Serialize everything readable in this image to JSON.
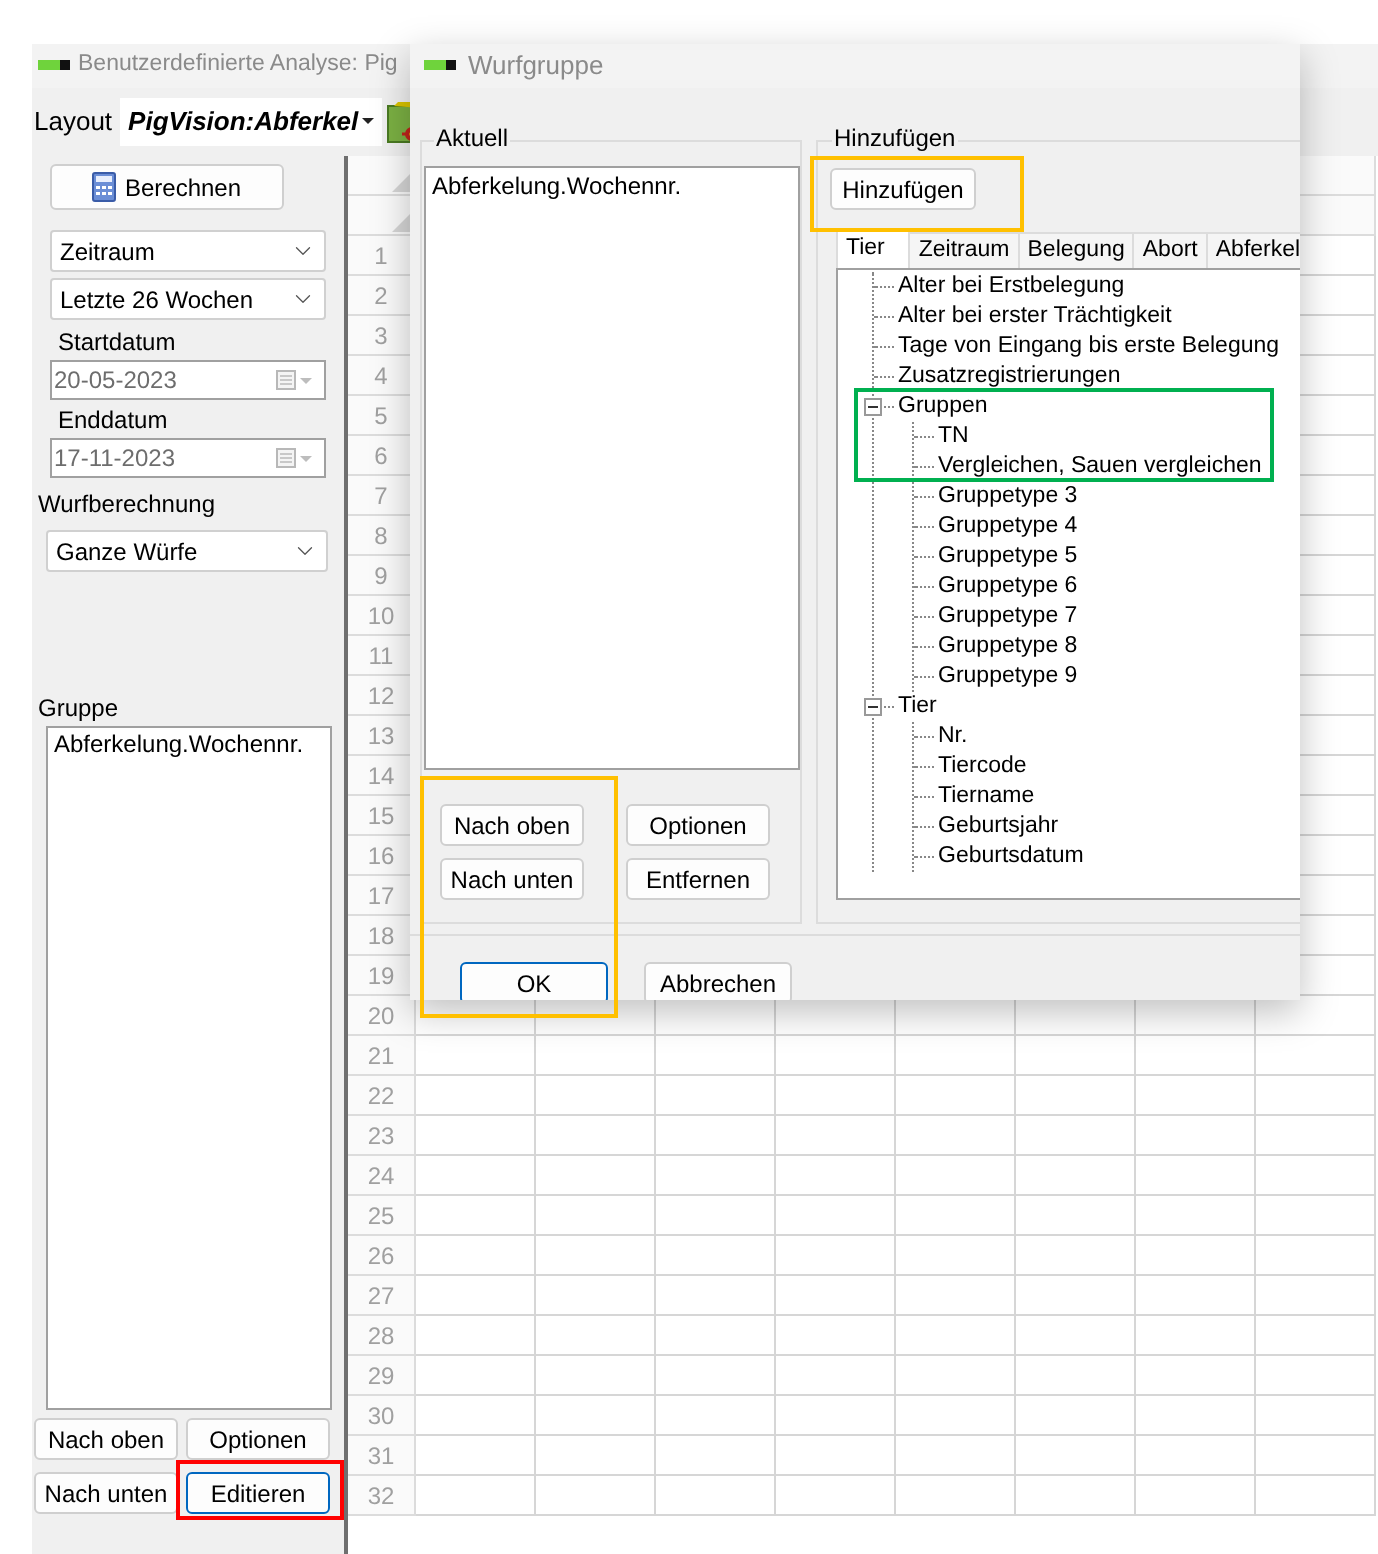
{
  "main_window": {
    "title": "Benutzerdefinierte Analyse: Pig",
    "layout_label": "Layout",
    "layout_value": "PigVision:Abferkel"
  },
  "sidebar": {
    "calculate_button": "Berechnen",
    "period_select": "Zeitraum",
    "range_select": "Letzte 26 Wochen",
    "start_label": "Startdatum",
    "start_date": {
      "value": "20-05-2023",
      "disabled": true
    },
    "end_label": "Enddatum",
    "end_date": {
      "value": "17-11-2023",
      "disabled": true
    },
    "litter_label": "Wurfberechnung",
    "litter_select": "Ganze Würfe",
    "group_label": "Gruppe",
    "group_list": [
      "Abferkelung.Wochennr."
    ],
    "buttons": [
      {
        "label": "Nach oben",
        "focused": false
      },
      {
        "label": "Optionen",
        "focused": false
      },
      {
        "label": "Nach unten",
        "focused": false
      },
      {
        "label": "Editieren",
        "focused": true
      }
    ]
  },
  "grid": {
    "row_numbers": [
      "1",
      "2",
      "3",
      "4",
      "5",
      "6",
      "7",
      "8",
      "9",
      "10",
      "11",
      "12",
      "13",
      "14",
      "15",
      "16",
      "17",
      "18",
      "19",
      "20",
      "21",
      "22",
      "23",
      "24",
      "25",
      "26",
      "27",
      "28",
      "29",
      "30",
      "31",
      "32"
    ]
  },
  "dialog": {
    "title": "Wurfgruppe",
    "current": {
      "legend": "Aktuell",
      "items": [
        "Abferkelung.Wochennr."
      ],
      "buttons": [
        {
          "label": "Nach oben"
        },
        {
          "label": "Optionen"
        },
        {
          "label": "Nach unten"
        },
        {
          "label": "Entfernen"
        }
      ]
    },
    "add": {
      "legend": "Hinzufügen",
      "button": "Hinzufügen",
      "tabs": [
        {
          "label": "Tier",
          "selected": true
        },
        {
          "label": "Zeitraum",
          "selected": false
        },
        {
          "label": "Belegung",
          "selected": false
        },
        {
          "label": "Abort",
          "selected": false
        },
        {
          "label": "Abferkel",
          "selected": false
        }
      ],
      "tree": [
        {
          "label": "Alter bei Erstbelegung"
        },
        {
          "label": "Alter bei erster Trächtigkeit"
        },
        {
          "label": "Tage von Eingang bis erste Belegung"
        },
        {
          "label": "Zusatzregistrierungen"
        },
        {
          "label": "Gruppen",
          "expanded": true,
          "children": [
            {
              "label": "TN"
            },
            {
              "label": "Vergleichen, Sauen vergleichen"
            },
            {
              "label": "Gruppetype 3"
            },
            {
              "label": "Gruppetype 4"
            },
            {
              "label": "Gruppetype 5"
            },
            {
              "label": "Gruppetype 6"
            },
            {
              "label": "Gruppetype 7"
            },
            {
              "label": "Gruppetype 8"
            },
            {
              "label": "Gruppetype 9"
            }
          ]
        },
        {
          "label": "Tier",
          "expanded": true,
          "children": [
            {
              "label": "Nr."
            },
            {
              "label": "Tiercode"
            },
            {
              "label": "Tiername"
            },
            {
              "label": "Geburtsjahr"
            },
            {
              "label": "Geburtsdatum"
            }
          ]
        }
      ]
    },
    "footer_buttons": [
      {
        "label": "OK",
        "focused": true
      },
      {
        "label": "Abbrechen",
        "focused": false
      }
    ]
  },
  "annotations": [
    {
      "color": "#ffc000"
    },
    {
      "color": "#00b050"
    },
    {
      "color": "#ffc000"
    },
    {
      "color": "#ff0000"
    }
  ]
}
